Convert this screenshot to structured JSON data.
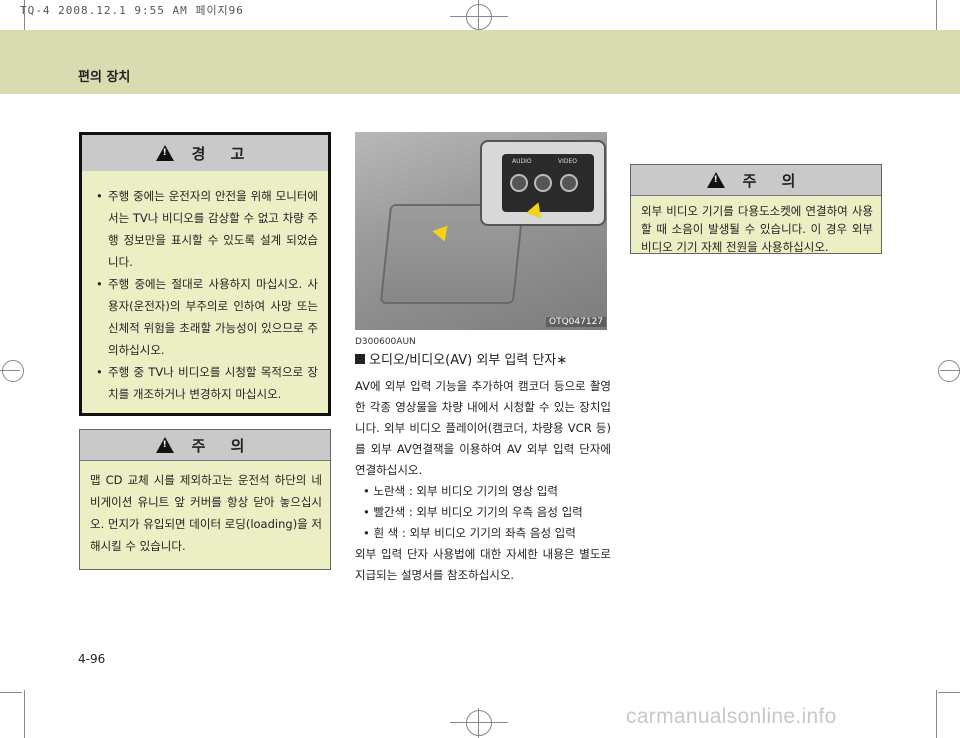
{
  "print_header": "TQ-4  2008.12.1 9:55 AM  페이지96",
  "section_header": "편의 장치",
  "warning": {
    "title": "경  고",
    "items": [
      "주행 중에는 운전자의 안전을 위해 모니터에서는 TV나 비디오를 감상할 수 없고 차량 주행 정보만을 표시할 수 있도록 설계 되었습니다.",
      "주행 중에는 절대로 사용하지 마십시오. 사용자(운전자)의 부주의로 인하여 사망 또는 신체적 위험을 초래할 가능성이 있으므로 주의하십시오.",
      "주행 중 TV나 비디오를 시청할 목적으로 장치를 개조하거나 변경하지 마십시오."
    ]
  },
  "caution1": {
    "title": "주  의",
    "text": "맵 CD 교체 시를 제외하고는 운전석 하단의 네비게이션 유니트 앞 커버를 항상 닫아 놓으십시오. 먼지가 유입되면 데이터 로딩(loading)을 저해시킬 수 있습니다."
  },
  "figure": {
    "code": "OTQ047127",
    "panel_labels": [
      "AUDIO",
      "VIDEO"
    ]
  },
  "section": {
    "code": "D300600AUN",
    "title": "오디오/비디오(AV) 외부 입력 단자∗",
    "paragraph1": "AV에 외부 입력 기능을 추가하여 캠코더 등으로 촬영한 각종 영상물을 차량 내에서 시청할 수 있는 장치입니다. 외부 비디오 플레이어(캠코더, 차량용 VCR 등)를 외부 AV연결잭을 이용하여 AV 외부 입력 단자에 연결하십시오.",
    "bullets": [
      "• 노란색 : 외부 비디오 기기의 영상 입력",
      "• 빨간색 : 외부 비디오 기기의 우측 음성 입력",
      "• 흰   색 : 외부 비디오 기기의 좌측 음성 입력"
    ],
    "paragraph2": "외부 입력 단자 사용법에 대한 자세한 내용은 별도로 지급되는 설명서를 참조하십시오."
  },
  "caution2": {
    "title": "주  의",
    "text": "외부 비디오 기기를 다용도소켓에 연결하여 사용할 때 소음이 발생될 수 있습니다. 이 경우 외부 비디오 기기 자체 전원을 사용하십시오."
  },
  "page_number": "4-96",
  "watermark": "carmanualsonline.info"
}
